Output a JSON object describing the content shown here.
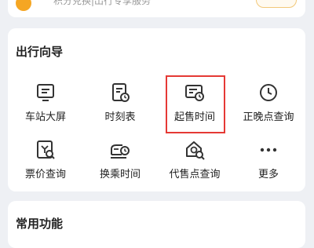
{
  "top_banner": {
    "subtitle": "积分兑换|出行专享服务"
  },
  "travel_guide": {
    "title": "出行向导",
    "items": [
      {
        "label": "车站大屏",
        "icon": "station-screen-icon"
      },
      {
        "label": "时刻表",
        "icon": "timetable-icon"
      },
      {
        "label": "起售时间",
        "icon": "ticket-sale-time-icon"
      },
      {
        "label": "正晚点查询",
        "icon": "clock-icon"
      },
      {
        "label": "票价查询",
        "icon": "fare-query-icon"
      },
      {
        "label": "换乘时间",
        "icon": "train-transfer-icon"
      },
      {
        "label": "代售点查询",
        "icon": "agency-search-icon"
      },
      {
        "label": "更多",
        "icon": "more-icon"
      }
    ]
  },
  "common_functions": {
    "title": "常用功能"
  },
  "colors": {
    "accent": "#f5a623",
    "highlight": "#e53935",
    "background": "#eef0f4",
    "icon": "#333333"
  }
}
